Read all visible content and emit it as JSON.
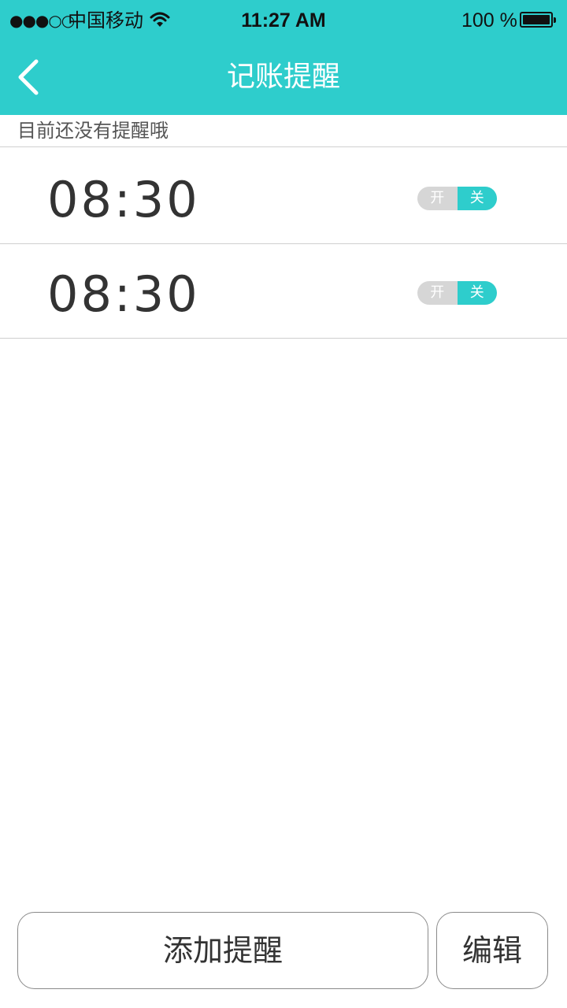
{
  "status_bar": {
    "signal": "●●●○○",
    "carrier": "中国移动",
    "time": "11:27 AM",
    "battery": "100 %"
  },
  "header": {
    "title": "记账提醒",
    "back_icon": "chevron-left-icon"
  },
  "empty_hint": "目前还没有提醒哦",
  "reminders": [
    {
      "time": "08:30",
      "toggle_on": "开",
      "toggle_off": "关",
      "state": "off"
    },
    {
      "time": "08:30",
      "toggle_on": "开",
      "toggle_off": "关",
      "state": "off"
    }
  ],
  "footer": {
    "add_label": "添加提醒",
    "edit_label": "编辑"
  },
  "colors": {
    "accent": "#2ecdcc",
    "toggle_inactive": "#d6d6d6"
  }
}
